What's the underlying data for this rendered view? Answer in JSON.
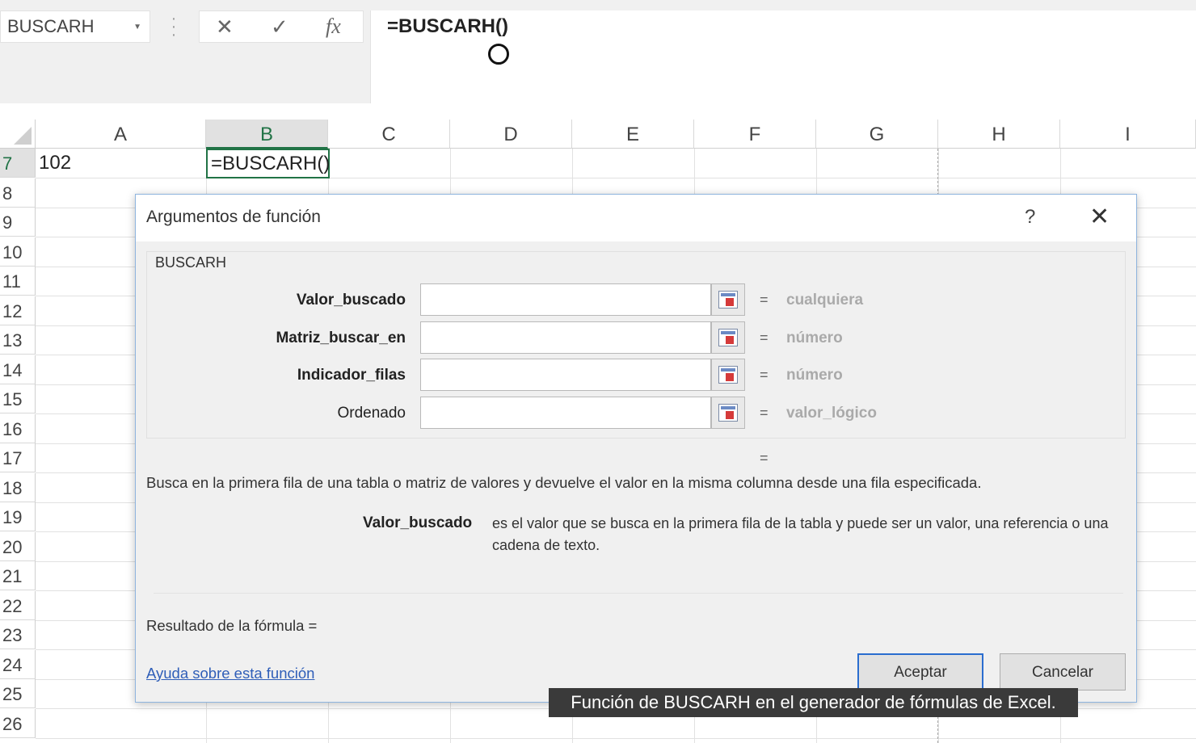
{
  "formula_bar": {
    "name_box": "BUSCARH",
    "cancel_icon": "✕",
    "enter_icon": "✓",
    "fx_label": "fx",
    "formula": "=BUSCARH()"
  },
  "grid": {
    "columns": [
      "A",
      "B",
      "C",
      "D",
      "E",
      "F",
      "G",
      "H",
      "I"
    ],
    "selected_column": "B",
    "rows": [
      "7",
      "8",
      "9",
      "10",
      "11",
      "12",
      "13",
      "14",
      "15",
      "16",
      "17",
      "18",
      "19",
      "20",
      "21",
      "22",
      "23",
      "24",
      "25",
      "26"
    ],
    "selected_row": "7",
    "cell_a7": "102",
    "cell_b7": "=BUSCARH()"
  },
  "dialog": {
    "title": "Argumentos de función",
    "help": "?",
    "close": "✕",
    "function_name": "BUSCARH",
    "arguments": [
      {
        "label": "Valor_buscado",
        "value": "",
        "equals": "=",
        "hint": "cualquiera",
        "bold": true
      },
      {
        "label": "Matriz_buscar_en",
        "value": "",
        "equals": "=",
        "hint": "número",
        "bold": true
      },
      {
        "label": "Indicador_filas",
        "value": "",
        "equals": "=",
        "hint": "número",
        "bold": true
      },
      {
        "label": "Ordenado",
        "value": "",
        "equals": "=",
        "hint": "valor_lógico",
        "bold": false
      }
    ],
    "result_equals": "=",
    "description": "Busca en la primera fila de una tabla o matriz de valores y devuelve el valor en la misma columna desde una fila especificada.",
    "arg_help_name": "Valor_buscado",
    "arg_help_text": "es el valor que se busca en la primera fila de la tabla y puede ser un valor, una referencia o una cadena de texto.",
    "formula_result": "Resultado de la fórmula =",
    "help_link": "Ayuda sobre esta función",
    "accept": "Aceptar",
    "cancel": "Cancelar"
  },
  "caption": "Función de BUSCARH en el generador de fórmulas de Excel.",
  "colors": {
    "accent": "#217346",
    "link": "#2f5eb8",
    "dialog_border": "#8eb4de"
  }
}
